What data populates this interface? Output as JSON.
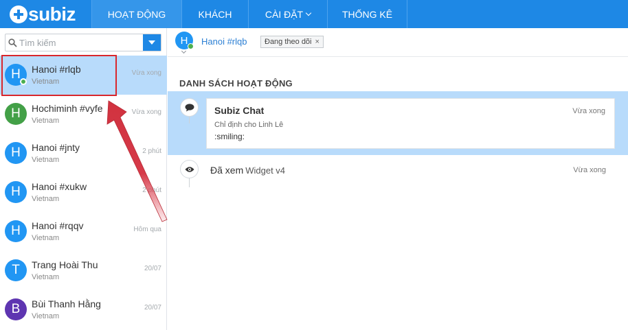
{
  "topbar": {
    "logo_text": "subiz",
    "tabs": [
      {
        "label": "HOẠT ĐỘNG"
      },
      {
        "label": "KHÁCH"
      },
      {
        "label": "CÀI ĐẶT"
      },
      {
        "label": "THỐNG KÊ"
      }
    ],
    "brand_color": "#1e88e5"
  },
  "sidebar": {
    "search": {
      "placeholder": "Tìm kiếm",
      "value": ""
    },
    "visitors": [
      {
        "initial": "H",
        "name": "Hanoi #rlqb",
        "country": "Vietnam",
        "time": "Vừa xong",
        "avatar_color": "#2196f3",
        "online": true,
        "selected": true
      },
      {
        "initial": "H",
        "name": "Hochiminh #vyfe",
        "country": "Vietnam",
        "time": "Vừa xong",
        "avatar_color": "#43a047",
        "online": false,
        "selected": false
      },
      {
        "initial": "H",
        "name": "Hanoi #jnty",
        "country": "Vietnam",
        "time": "2 phút",
        "avatar_color": "#2196f3",
        "online": false,
        "selected": false
      },
      {
        "initial": "H",
        "name": "Hanoi #xukw",
        "country": "Vietnam",
        "time": "2 phút",
        "avatar_color": "#2196f3",
        "online": false,
        "selected": false
      },
      {
        "initial": "H",
        "name": "Hanoi #rqqv",
        "country": "Vietnam",
        "time": "Hôm qua",
        "avatar_color": "#2196f3",
        "online": false,
        "selected": false
      },
      {
        "initial": "T",
        "name": "Trang Hoài Thu",
        "country": "Vietnam",
        "time": "20/07",
        "avatar_color": "#2196f3",
        "online": false,
        "selected": false
      },
      {
        "initial": "B",
        "name": "Bùi Thanh Hằng",
        "country": "Vietnam",
        "time": "20/07",
        "avatar_color": "#5e35b1",
        "online": false,
        "selected": false
      }
    ]
  },
  "main": {
    "header": {
      "initial": "H",
      "name": "Hanoi #rlqb",
      "follow_label": "Đang theo dõi",
      "follow_close": "×"
    },
    "section_title": "DANH SÁCH HOẠT ĐỘNG",
    "activities": [
      {
        "title": "Subiz Chat",
        "subtitle": "Chỉ định cho Linh Lê",
        "message": ":smiling:",
        "time": "Vừa xong",
        "icon": "chat-bubble-icon"
      },
      {
        "title": "Đã xem",
        "target": "Widget v4",
        "time": "Vừa xong",
        "icon": "eye-icon"
      }
    ]
  },
  "annotation": {
    "highlight_color": "#d9262b",
    "arrow_color": "#d43a4a"
  }
}
